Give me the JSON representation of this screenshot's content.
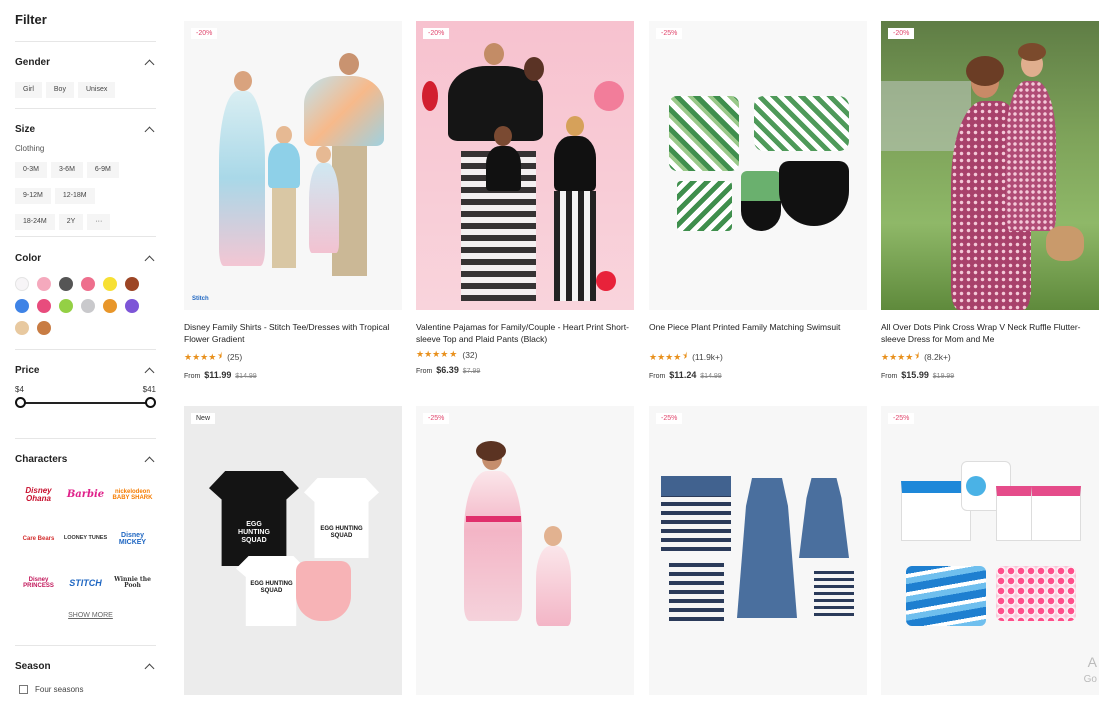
{
  "filter": {
    "title": "Filter",
    "gender": {
      "title": "Gender",
      "options": [
        "Girl",
        "Boy",
        "Unisex"
      ]
    },
    "size": {
      "title": "Size",
      "sublabel": "Clothing",
      "options": [
        "0-3M",
        "3-6M",
        "6-9M",
        "9-12M",
        "12-18M",
        "18-24M",
        "2Y",
        "···"
      ]
    },
    "color": {
      "title": "Color",
      "swatches": [
        "#f7f5f7",
        "#f5a9bd",
        "#555555",
        "#ee6f8d",
        "#f7e034",
        "#9c4525",
        "#3f83e6",
        "#e84c7d",
        "#94d045",
        "#c9c9cc",
        "#e8962a",
        "#7d55d7",
        "#e8c9a0",
        "#c87c43"
      ]
    },
    "price": {
      "title": "Price",
      "min": "$4",
      "max": "$41"
    },
    "characters": {
      "title": "Characters",
      "logos": [
        "Disney Ohana",
        "Barbie",
        "nickelodeon BABY SHARK",
        "Care Bears",
        "LOONEY TUNES",
        "Disney MICKEY",
        "Disney PRINCESS",
        "STITCH",
        "Winnie the Pooh"
      ],
      "show_more": "SHOW MORE"
    },
    "season": {
      "title": "Season",
      "option": "Four seasons"
    }
  },
  "products": [
    {
      "badge": "-20%",
      "name": "Disney Family Shirts - Stitch Tee/Dresses with Tropical Flower Gradient",
      "rating_count": "(25)",
      "from": "From",
      "price": "$11.99",
      "old_price": "$14.99"
    },
    {
      "badge": "-20%",
      "name": "Valentine Pajamas for Family/Couple - Heart Print Short-sleeve Top and Plaid Pants (Black)",
      "rating_count": "(32)",
      "from": "From",
      "price": "$6.39",
      "old_price": "$7.99"
    },
    {
      "badge": "-25%",
      "name": "One Piece Plant Printed Family Matching Swimsuit",
      "rating_count": "(11.9k+)",
      "from": "From",
      "price": "$11.24",
      "old_price": "$14.99"
    },
    {
      "badge": "-20%",
      "name": "All Over Dots Pink Cross Wrap V Neck Ruffle Flutter-sleeve Dress for Mom and Me",
      "rating_count": "(8.2k+)",
      "from": "From",
      "price": "$15.99",
      "old_price": "$19.99"
    },
    {
      "badge": "New"
    },
    {
      "badge": "-25%"
    },
    {
      "badge": "-25%"
    },
    {
      "badge": "-25%"
    }
  ],
  "stars": "★★★★",
  "half_star": "⯨",
  "img_text": {
    "stitch_logo": "Stitch",
    "squad": "EGG HUNTING SQUAD",
    "corner_a": "A",
    "corner_go": "Go"
  }
}
